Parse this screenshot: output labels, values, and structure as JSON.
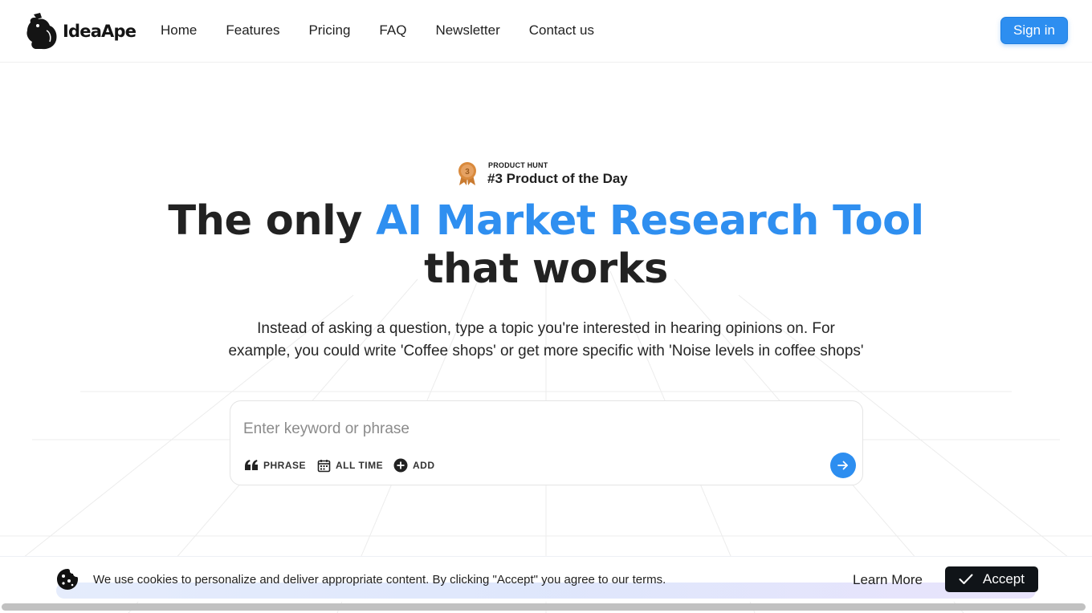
{
  "header": {
    "brand": "IdeaApe",
    "nav": [
      "Home",
      "Features",
      "Pricing",
      "FAQ",
      "Newsletter",
      "Contact us"
    ],
    "signin_label": "Sign in"
  },
  "badge": {
    "rank": "3",
    "source": "PRODUCT HUNT",
    "title": "#3 Product of the Day"
  },
  "hero": {
    "headline_start": "The only ",
    "headline_accent": "AI Market Research Tool",
    "headline_end": "that works",
    "description": "Instead of asking a question, type a topic you're interested in hearing opinions on. For example, you could write 'Coffee shops' or get more specific with 'Noise levels in coffee shops'"
  },
  "search": {
    "placeholder": "Enter keyword or phrase",
    "value": "",
    "options": {
      "phrase": "PHRASE",
      "time": "ALL TIME",
      "add": "ADD"
    }
  },
  "cookie": {
    "message": "We use cookies to personalize and deliver appropriate content. By clicking \"Accept\" you agree to our terms.",
    "learn_more": "Learn More",
    "accept": "Accept"
  },
  "colors": {
    "accent": "#2f8ff0",
    "button": "#2d8ef0",
    "accept_bg": "#101418",
    "medal": "#d98a3d"
  },
  "icons": {
    "logo": "ape-logo-icon",
    "medal": "medal-icon",
    "phrase": "quote-icon",
    "time": "calendar-icon",
    "add": "plus-circle-icon",
    "go": "arrow-right-icon",
    "cookie": "cookie-icon",
    "accept": "check-icon"
  }
}
